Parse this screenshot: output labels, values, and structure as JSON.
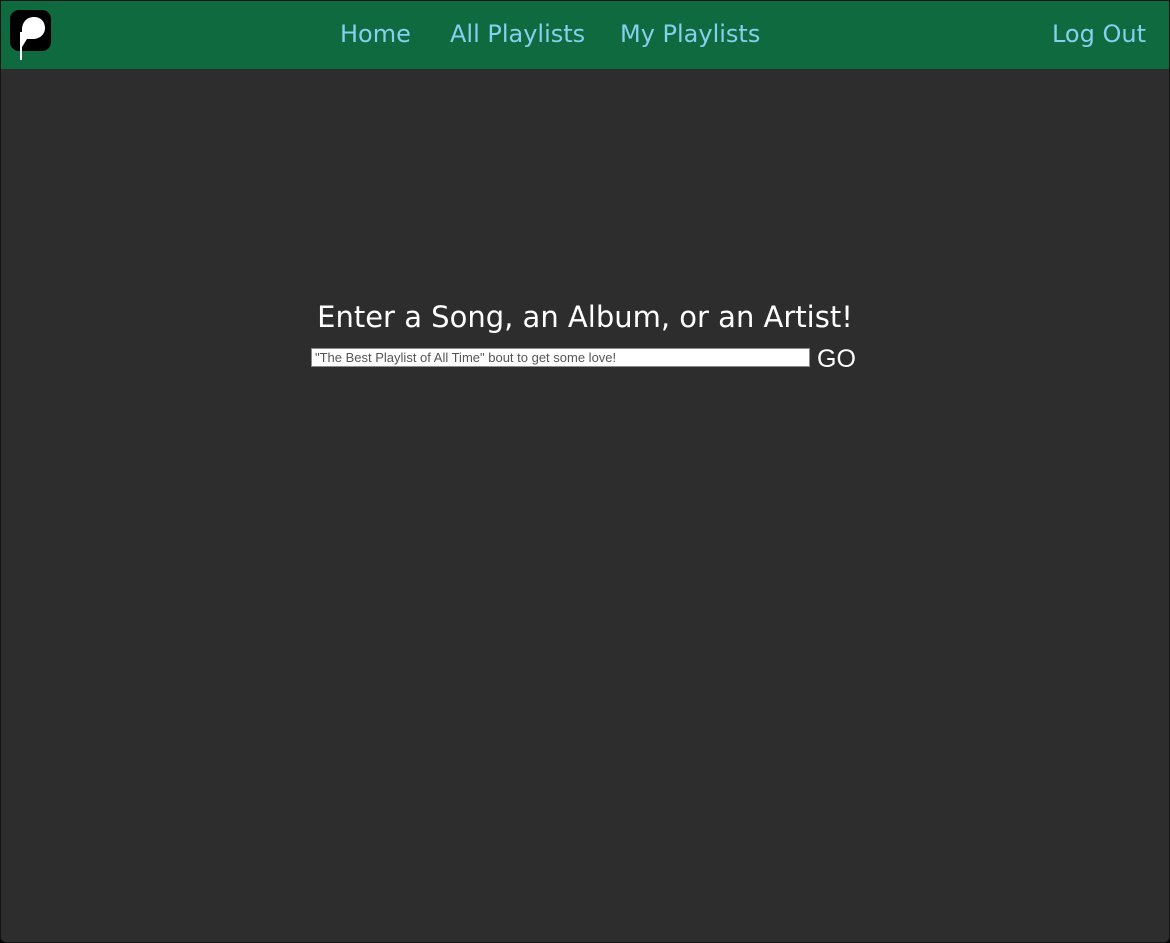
{
  "app": {
    "logo_icon": "playlist-p-logo-icon"
  },
  "nav": {
    "home": "Home",
    "all_playlists": "All Playlists",
    "my_playlists": "My Playlists",
    "log_out": "Log Out"
  },
  "search": {
    "heading": "Enter a Song, an Album, or an Artist!",
    "placeholder": "\"The Best Playlist of All Time\" bout to get some love!",
    "value": "",
    "go_label": "GO"
  },
  "colors": {
    "navbar_bg": "#0f6b3f",
    "nav_link": "#86cfee",
    "page_bg": "#2d2d2d",
    "text": "#ffffff"
  }
}
